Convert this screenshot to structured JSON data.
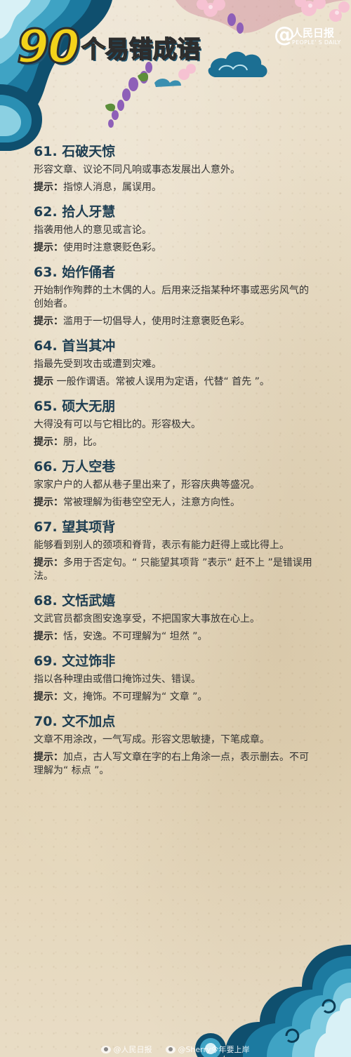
{
  "header": {
    "title_number": "90",
    "title_text": "个易错成语",
    "logo_at": "@",
    "logo_cn": "人民日报",
    "logo_en": "PEOPLE' S DAILY"
  },
  "hint_label": "提示：",
  "hint_label_nocolon": "提示",
  "entries": [
    {
      "title": "61. 石破天惊",
      "definition": "形容文章、议论不同凡响或事态发展出人意外。",
      "hint": "指惊人消息，属误用。"
    },
    {
      "title": "62. 拾人牙慧",
      "definition": "指袭用他人的意见或言论。",
      "hint": "使用时注意褒贬色彩。"
    },
    {
      "title": "63. 始作俑者",
      "definition": "开始制作殉葬的土木偶的人。后用来泛指某种坏事或恶劣风气的创始者。",
      "hint": "滥用于一切倡导人，使用时注意褒贬色彩。"
    },
    {
      "title": "64. 首当其冲",
      "definition": "指最先受到攻击或遭到灾难。",
      "hint": " 一般作谓语。常被人误用为定语，代替“ 首先 ”。"
    },
    {
      "title": "65. 硕大无朋",
      "definition": "大得没有可以与它相比的。形容极大。",
      "hint": "朋，比。"
    },
    {
      "title": "66. 万人空巷",
      "definition": "家家户户的人都从巷子里出来了，形容庆典等盛况。",
      "hint": "常被理解为街巷空空无人，注意方向性。"
    },
    {
      "title": "67. 望其项背",
      "definition": "能够看到别人的颈项和脊背，表示有能力赶得上或比得上。",
      "hint": "多用于否定句。“ 只能望其项背 ”表示“ 赶不上 ”是错误用法。"
    },
    {
      "title": "68. 文恬武嬉",
      "definition": "文武官员都贪图安逸享受，不把国家大事放在心上。",
      "hint": "恬，安逸。不可理解为“ 坦然 ”。"
    },
    {
      "title": "69. 文过饰非",
      "definition": "指以各种理由或借口掩饰过失、错误。",
      "hint": "文，掩饰。不可理解为“ 文章 ”。"
    },
    {
      "title": "70. 文不加点",
      "definition": "文章不用涂改，一气写成。形容文思敏捷，下笔成章。",
      "hint": "加点，古人写文章在字的右上角涂一点，表示删去。不可理解为“ 标点 ”。"
    }
  ],
  "watermark": {
    "left": "@人民日报",
    "right": "@Sherry今年要上岸"
  },
  "colors": {
    "title_yellow": "#f3d21a",
    "wave_blue": "#1f6f95",
    "entry_title": "#1e3e52",
    "parchment": "#e6d9bf"
  }
}
